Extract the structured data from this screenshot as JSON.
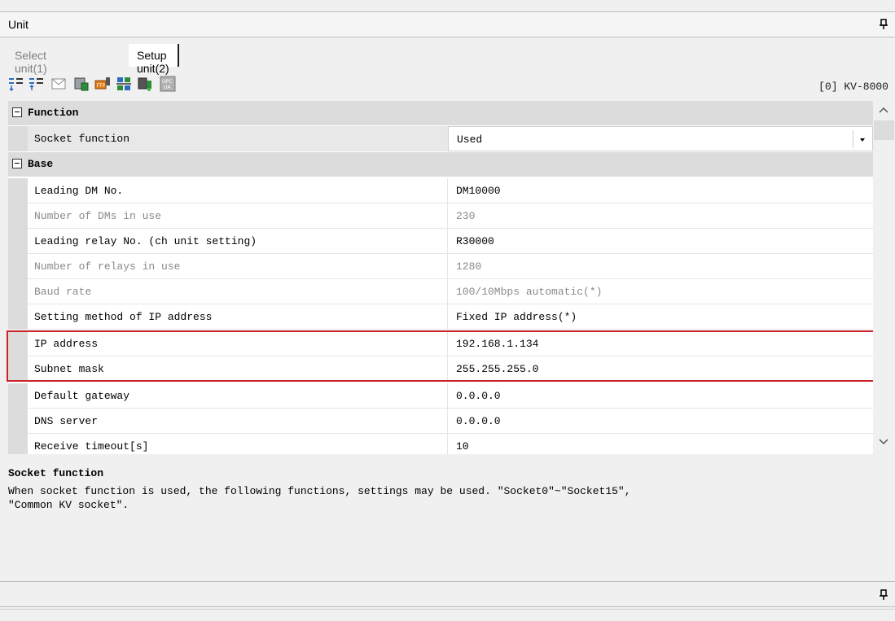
{
  "panel": {
    "title": "Unit"
  },
  "tabs": [
    {
      "label": "Select unit(1)"
    },
    {
      "label": "Setup unit(2)"
    }
  ],
  "toolbar": {
    "icons": [
      "sort-down-icon",
      "sort-up-icon",
      "mail-icon",
      "unit-icon",
      "ftp-icon",
      "network-icon",
      "device-status-icon",
      "opc-ua-icon"
    ],
    "model_label": "[0] KV-8000"
  },
  "grid": {
    "categories": [
      {
        "label": "Function"
      },
      {
        "label": "Base"
      }
    ],
    "function_rows": [
      {
        "name": "Socket function",
        "value": "Used"
      }
    ],
    "base_rows": [
      {
        "name": "Leading DM No.",
        "value": "DM10000"
      },
      {
        "name": "Number of DMs in use",
        "value": "230"
      },
      {
        "name": "Leading relay No. (ch unit setting)",
        "value": "R30000"
      },
      {
        "name": "Number of relays in use",
        "value": "1280"
      },
      {
        "name": "Baud rate",
        "value": "100/10Mbps automatic(*)"
      },
      {
        "name": "Setting method of IP address",
        "value": "Fixed IP address(*)"
      },
      {
        "name": "IP address",
        "value": "192.168.1.134"
      },
      {
        "name": "Subnet mask",
        "value": "255.255.255.0"
      },
      {
        "name": "Default gateway",
        "value": "0.0.0.0"
      },
      {
        "name": "DNS server",
        "value": "0.0.0.0"
      },
      {
        "name": "Receive timeout[s]",
        "value": "10"
      }
    ]
  },
  "description": {
    "title": "Socket function",
    "text": "When socket function is used, the following functions, settings may be used. \"Socket0\"~\"Socket15\",\n\"Common KV socket\"."
  },
  "colors": {
    "highlight": "#c8242a",
    "category_bg": "#dcdcdc",
    "disabled_text": "#8a8a8a"
  }
}
